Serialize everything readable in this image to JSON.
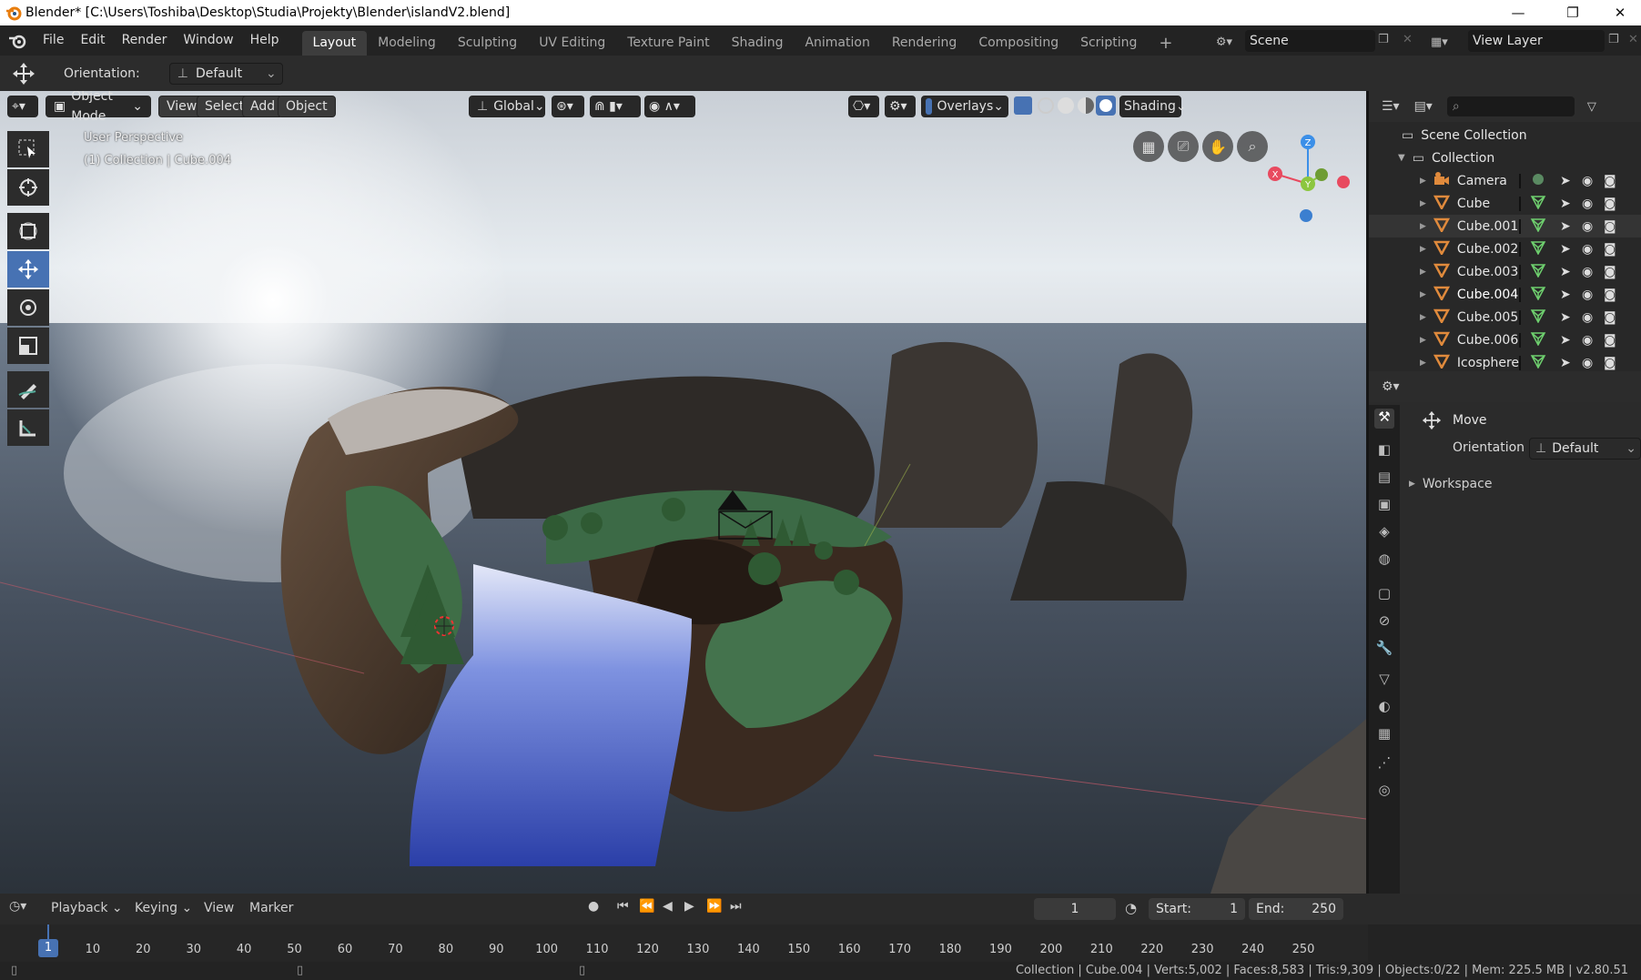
{
  "titlebar": {
    "title": "Blender* [C:\\Users\\Toshiba\\Desktop\\Studia\\Projekty\\Blender\\islandV2.blend]",
    "minimize": "—",
    "maximize": "❐",
    "close": "✕"
  },
  "menu": {
    "items": [
      "File",
      "Edit",
      "Render",
      "Window",
      "Help"
    ],
    "workspaces": [
      "Layout",
      "Modeling",
      "Sculpting",
      "UV Editing",
      "Texture Paint",
      "Shading",
      "Animation",
      "Rendering",
      "Compositing",
      "Scripting"
    ],
    "active_workspace": "Layout",
    "add_workspace": "+",
    "scene": "Scene",
    "view_layer": "View Layer"
  },
  "toolheader": {
    "orientation_label": "Orientation:",
    "orientation_value": "Default"
  },
  "viewport": {
    "mode": "Object Mode",
    "menus": [
      "View",
      "Select",
      "Add",
      "Object"
    ],
    "transform_orientation": "Global",
    "overlays_label": "Overlays",
    "shading_label": "Shading",
    "info_line1": "User Perspective",
    "info_line2": "(1) Collection | Cube.004",
    "gizmo": {
      "x": "X",
      "y": "Y",
      "z": "Z"
    }
  },
  "outliner": {
    "scene_collection": "Scene Collection",
    "collection": "Collection",
    "items": [
      {
        "name": "Camera",
        "type": "camera"
      },
      {
        "name": "Cube",
        "type": "mesh"
      },
      {
        "name": "Cube.001",
        "type": "mesh"
      },
      {
        "name": "Cube.002",
        "type": "mesh"
      },
      {
        "name": "Cube.003",
        "type": "mesh"
      },
      {
        "name": "Cube.004",
        "type": "mesh"
      },
      {
        "name": "Cube.005",
        "type": "mesh"
      },
      {
        "name": "Cube.006",
        "type": "mesh"
      },
      {
        "name": "Icosphere",
        "type": "mesh"
      }
    ],
    "highlighted": "Cube.001",
    "active": "Cube.004"
  },
  "properties": {
    "tool_name": "Move",
    "orientation_label": "Orientation",
    "orientation_value": "Default",
    "workspace_panel": "Workspace"
  },
  "timeline": {
    "menus": [
      "Playback",
      "Keying",
      "View",
      "Marker"
    ],
    "current_frame": "1",
    "start_label": "Start:",
    "start_value": "1",
    "end_label": "End:",
    "end_value": "250",
    "ticks": [
      "10",
      "20",
      "30",
      "40",
      "50",
      "60",
      "70",
      "80",
      "90",
      "100",
      "110",
      "120",
      "130",
      "140",
      "150",
      "160",
      "170",
      "180",
      "190",
      "200",
      "210",
      "220",
      "230",
      "240",
      "250"
    ],
    "cursor_frame": "1"
  },
  "statusbar": {
    "text": "Collection | Cube.004 | Verts:5,002 | Faces:8,583 | Tris:9,309 | Objects:0/22 | Mem: 225.5 MB | v2.80.51"
  },
  "colors": {
    "accent": "#4772b3",
    "mesh_icon": "#e08a3c",
    "data_icon": "#6ecf6e",
    "axis_x": "#e84a5f",
    "axis_y": "#8cc63f",
    "axis_z": "#3b8fe8"
  }
}
